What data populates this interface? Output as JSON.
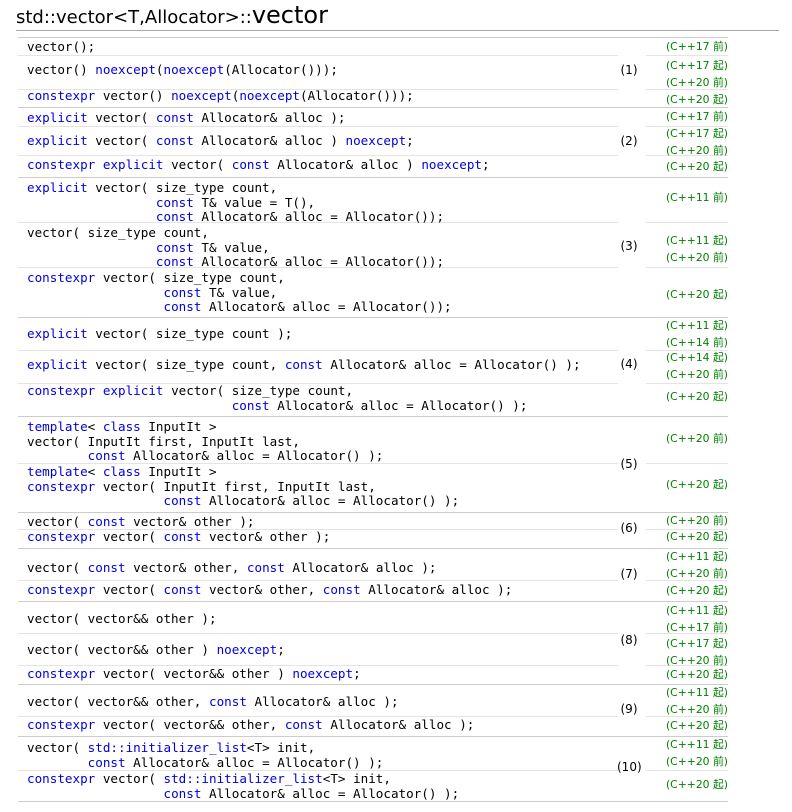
{
  "title": {
    "prefix": "std::vector<T,Allocator>::",
    "name": "vector"
  },
  "colors": {
    "keyword": "#0000dd",
    "version": "#008000",
    "rule": "#cccccc"
  },
  "groups": [
    {
      "num": "(1)",
      "entries": [
        {
          "code": [
            [
              [
                "vector();",
                0
              ]
            ]
          ],
          "ver": [
            "(C++17 前)"
          ]
        },
        {
          "code": [
            [
              [
                "vector() ",
                0
              ],
              [
                "noexcept",
                1
              ],
              [
                "(",
                0
              ],
              [
                "noexcept",
                1
              ],
              [
                "(Allocator()));",
                0
              ]
            ]
          ],
          "ver": [
            "(C++17 起)",
            "(C++20 前)"
          ]
        },
        {
          "code": [
            [
              [
                "constexpr",
                1
              ],
              [
                " vector() ",
                0
              ],
              [
                "noexcept",
                1
              ],
              [
                "(",
                0
              ],
              [
                "noexcept",
                1
              ],
              [
                "(Allocator()));",
                0
              ]
            ]
          ],
          "ver": [
            "(C++20 起)"
          ]
        }
      ]
    },
    {
      "num": "(2)",
      "entries": [
        {
          "code": [
            [
              [
                "explicit",
                1
              ],
              [
                " vector( ",
                0
              ],
              [
                "const",
                1
              ],
              [
                " Allocator& alloc );",
                0
              ]
            ]
          ],
          "ver": [
            "(C++17 前)"
          ]
        },
        {
          "code": [
            [
              [
                "explicit",
                1
              ],
              [
                " vector( ",
                0
              ],
              [
                "const",
                1
              ],
              [
                " Allocator& alloc ) ",
                0
              ],
              [
                "noexcept",
                1
              ],
              [
                ";",
                0
              ]
            ]
          ],
          "ver": [
            "(C++17 起)",
            "(C++20 前)"
          ]
        },
        {
          "code": [
            [
              [
                "constexpr",
                1
              ],
              [
                " ",
                0
              ],
              [
                "explicit",
                1
              ],
              [
                " vector( ",
                0
              ],
              [
                "const",
                1
              ],
              [
                " Allocator& alloc ) ",
                0
              ],
              [
                "noexcept",
                1
              ],
              [
                ";",
                0
              ]
            ]
          ],
          "ver": [
            "(C++20 起)"
          ]
        }
      ]
    },
    {
      "num": "(3)",
      "entries": [
        {
          "code": [
            [
              [
                "explicit",
                1
              ],
              [
                " vector( size_type count,",
                0
              ]
            ],
            [
              [
                "                 ",
                0
              ],
              [
                "const",
                1
              ],
              [
                " T& value = T(),",
                0
              ]
            ],
            [
              [
                "                 ",
                0
              ],
              [
                "const",
                1
              ],
              [
                " Allocator& alloc = Allocator());",
                0
              ]
            ]
          ],
          "ver": [
            "(C++11 前)"
          ]
        },
        {
          "code": [
            [
              [
                "vector( size_type count,",
                0
              ]
            ],
            [
              [
                "                 ",
                0
              ],
              [
                "const",
                1
              ],
              [
                " T& value,",
                0
              ]
            ],
            [
              [
                "                 ",
                0
              ],
              [
                "const",
                1
              ],
              [
                " Allocator& alloc = Allocator());",
                0
              ]
            ]
          ],
          "ver": [
            "(C++11 起)",
            "(C++20 前)"
          ]
        },
        {
          "code": [
            [
              [
                "constexpr",
                1
              ],
              [
                " vector( size_type count,",
                0
              ]
            ],
            [
              [
                "                  ",
                0
              ],
              [
                "const",
                1
              ],
              [
                " T& value,",
                0
              ]
            ],
            [
              [
                "                  ",
                0
              ],
              [
                "const",
                1
              ],
              [
                " Allocator& alloc = Allocator());",
                0
              ]
            ]
          ],
          "ver": [
            "(C++20 起)"
          ]
        }
      ]
    },
    {
      "num": "(4)",
      "entries": [
        {
          "code": [
            [
              [
                "explicit",
                1
              ],
              [
                " vector( size_type count );",
                0
              ]
            ]
          ],
          "ver": [
            "(C++11 起)",
            "(C++14 前)"
          ]
        },
        {
          "code": [
            [
              [
                "explicit",
                1
              ],
              [
                " vector( size_type count, ",
                0
              ],
              [
                "const",
                1
              ],
              [
                " Allocator& alloc = Allocator() );",
                0
              ]
            ]
          ],
          "ver": [
            "(C++14 起)",
            "(C++20 前)"
          ]
        },
        {
          "code": [
            [
              [
                "constexpr",
                1
              ],
              [
                " ",
                0
              ],
              [
                "explicit",
                1
              ],
              [
                " vector( size_type count,",
                0
              ]
            ],
            [
              [
                "                           ",
                0
              ],
              [
                "const",
                1
              ],
              [
                " Allocator& alloc = Allocator() );",
                0
              ]
            ]
          ],
          "ver": [
            "(C++20 起)"
          ]
        }
      ]
    },
    {
      "num": "(5)",
      "entries": [
        {
          "code": [
            [
              [
                "template",
                1
              ],
              [
                "< ",
                0
              ],
              [
                "class",
                1
              ],
              [
                " InputIt >",
                0
              ]
            ],
            [
              [
                "vector( InputIt first, InputIt last,",
                0
              ]
            ],
            [
              [
                "        ",
                0
              ],
              [
                "const",
                1
              ],
              [
                " Allocator& alloc = Allocator() );",
                0
              ]
            ]
          ],
          "ver": [
            "(C++20 前)"
          ]
        },
        {
          "code": [
            [
              [
                "template",
                1
              ],
              [
                "< ",
                0
              ],
              [
                "class",
                1
              ],
              [
                " InputIt >",
                0
              ]
            ],
            [
              [
                "constexpr",
                1
              ],
              [
                " vector( InputIt first, InputIt last,",
                0
              ]
            ],
            [
              [
                "                  ",
                0
              ],
              [
                "const",
                1
              ],
              [
                " Allocator& alloc = Allocator() );",
                0
              ]
            ]
          ],
          "ver": [
            "(C++20 起)"
          ]
        }
      ]
    },
    {
      "num": "(6)",
      "entries": [
        {
          "code": [
            [
              [
                "vector( ",
                0
              ],
              [
                "const",
                1
              ],
              [
                " vector& other );",
                0
              ]
            ]
          ],
          "ver": [
            "(C++20 前)"
          ]
        },
        {
          "code": [
            [
              [
                "constexpr",
                1
              ],
              [
                " vector( ",
                0
              ],
              [
                "const",
                1
              ],
              [
                " vector& other );",
                0
              ]
            ]
          ],
          "ver": [
            "(C++20 起)"
          ]
        }
      ]
    },
    {
      "num": "(7)",
      "entries": [
        {
          "code": [
            [
              [
                "vector( ",
                0
              ],
              [
                "const",
                1
              ],
              [
                " vector& other, ",
                0
              ],
              [
                "const",
                1
              ],
              [
                " Allocator& alloc );",
                0
              ]
            ]
          ],
          "ver": [
            "(C++11 起)",
            "(C++20 前)"
          ]
        },
        {
          "code": [
            [
              [
                "constexpr",
                1
              ],
              [
                " vector( ",
                0
              ],
              [
                "const",
                1
              ],
              [
                " vector& other, ",
                0
              ],
              [
                "const",
                1
              ],
              [
                " Allocator& alloc );",
                0
              ]
            ]
          ],
          "ver": [
            "(C++20 起)"
          ]
        }
      ]
    },
    {
      "num": "(8)",
      "entries": [
        {
          "code": [
            [
              [
                "vector( vector&& other );",
                0
              ]
            ]
          ],
          "ver": [
            "(C++11 起)",
            "(C++17 前)"
          ]
        },
        {
          "code": [
            [
              [
                "vector( vector&& other ) ",
                0
              ],
              [
                "noexcept",
                1
              ],
              [
                ";",
                0
              ]
            ]
          ],
          "ver": [
            "(C++17 起)",
            "(C++20 前)"
          ]
        },
        {
          "code": [
            [
              [
                "constexpr",
                1
              ],
              [
                " vector( vector&& other ) ",
                0
              ],
              [
                "noexcept",
                1
              ],
              [
                ";",
                0
              ]
            ]
          ],
          "ver": [
            "(C++20 起)"
          ]
        }
      ]
    },
    {
      "num": "(9)",
      "entries": [
        {
          "code": [
            [
              [
                "vector( vector&& other, ",
                0
              ],
              [
                "const",
                1
              ],
              [
                " Allocator& alloc );",
                0
              ]
            ]
          ],
          "ver": [
            "(C++11 起)",
            "(C++20 前)"
          ]
        },
        {
          "code": [
            [
              [
                "constexpr",
                1
              ],
              [
                " vector( vector&& other, ",
                0
              ],
              [
                "const",
                1
              ],
              [
                " Allocator& alloc );",
                0
              ]
            ]
          ],
          "ver": [
            "(C++20 起)"
          ]
        }
      ]
    },
    {
      "num": "(10)",
      "entries": [
        {
          "code": [
            [
              [
                "vector( ",
                0
              ],
              [
                "std::initializer_list",
                1
              ],
              [
                "<T> init,",
                0
              ]
            ],
            [
              [
                "        ",
                0
              ],
              [
                "const",
                1
              ],
              [
                " Allocator& alloc = Allocator() );",
                0
              ]
            ]
          ],
          "ver": [
            "(C++11 起)",
            "(C++20 前)"
          ]
        },
        {
          "code": [
            [
              [
                "constexpr",
                1
              ],
              [
                " vector( ",
                0
              ],
              [
                "std::initializer_list",
                1
              ],
              [
                "<T> init,",
                0
              ]
            ],
            [
              [
                "                  ",
                0
              ],
              [
                "const",
                1
              ],
              [
                " Allocator& alloc = Allocator() );",
                0
              ]
            ]
          ],
          "ver": [
            "(C++20 起)"
          ]
        }
      ]
    }
  ]
}
